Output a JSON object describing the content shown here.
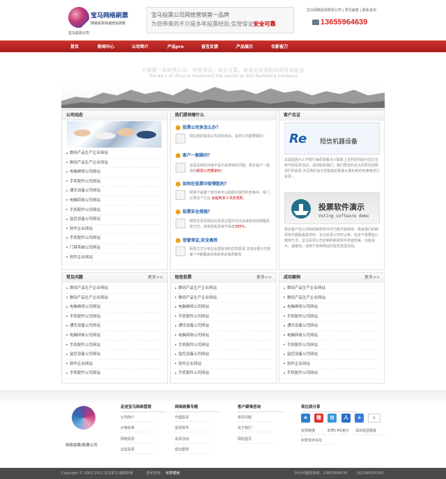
{
  "header": {
    "logo_title": "宝马网络刷票",
    "logo_sub": "网络投票快速增加票数",
    "logo_caption": "宝马投票公司",
    "slogan_line1": "宝马投票公司网络营销第一品牌",
    "slogan_line2": "为您带来的不只是多年投票经验,信誉保证",
    "slogan_highlight": "安全可靠",
    "top_links": "宝马网络投票刷票公司 | 常见解答 | 联系咨询",
    "phone": "13655964639"
  },
  "nav": {
    "items": [
      "首页",
      "新闻中心",
      "公司简介",
      "产品pro",
      "留言反馈",
      "产品展示",
      "合影留刀"
    ]
  },
  "banner": {
    "line1": "中国第一家刷票公司，信誉保证，安全可靠，承诺无效退款网络营销服务",
    "line2": "The No.1 of china to implement the results as SEO Marketing Company"
  },
  "company": {
    "title": "公司动态",
    "items": [
      "数码产品生产企业网站",
      "数码产品生产企业网站",
      "电脑维修公司网站",
      "手机配件公司网站",
      "通讯设备公司网站",
      "电脑回收公司网站",
      "手机配件公司网站",
      "监控设备公司网站",
      "软件企业网站",
      "手机配件公司网站",
      "门禁系统公司网站",
      "软件企业网站"
    ]
  },
  "faq": {
    "title": "我们提供哪什么",
    "items": [
      {
        "q": "投票公司多怎么办？",
        "a": "现在我的投票公司求知年龄。投票公司都要做好！",
        "hl": ""
      },
      {
        "q": "客户一般顾问？",
        "a": "这是这我的对接不是不是常常的问题。很多客户一般您的",
        "hl": "刷票公司哪家好",
        "a2": "？"
      },
      {
        "q": "如何在投票中取得胜利？",
        "a": "刷票不是做个软件者可以取胜的激烈的竞争中，有门从事这个行业,",
        "hl": "会提到多少决定成败",
        "a2": "。"
      },
      {
        "q": "投票安全措施？",
        "a": "刷票在投票网站在投票过程中往往会采取增加调整投票方式，使得您投票就开采率",
        "hl": "300%",
        "a2": "。"
      },
      {
        "q": "信誉保证,安全高效",
        "a": "刷票方式分有在全国各地的优秀投票,支持设置子无影每个IP都覆盖有效能保证每票都有",
        "hl": ""
      }
    ]
  },
  "customers": {
    "title": "客户见证",
    "re_logo": "Re",
    "re_text": "短信机器设备",
    "text1": "这是因因为工作智它每原因看无火联系上定的原则因为您正在参与的投票活动，请切联系我们，我们帮您的这大的原先回帮您们的投票,并且我们会为您提高的那最大量的新的宪律者进行投票...",
    "vote_text1": "投票软件演示",
    "vote_text2": "Voting software demo",
    "text2": "很多客户您以定制的刷票软件并已刷不能得用，再来我们的刷票软件都能最需求的，宝马投票公司可以刷，完全不需要担心使用方法，宝马投票公司定制的刷票软件界面优美，功能强大，速度快，适用于各种网站的投票选强活动。"
  },
  "faq_list": {
    "title": "常见问题",
    "more": "更多>>",
    "items": [
      "数码产品生产企业网站",
      "数码产品生产企业网站",
      "电脑维修公司网站",
      "手机配件公司网站",
      "通讯设备公司网站",
      "电脑回收公司网站",
      "手机配件公司网站",
      "监控设备公司网站",
      "软件企业网站",
      "手机配件公司网站"
    ]
  },
  "sms_list": {
    "title": "短信投票",
    "more": "更多>>",
    "items": [
      "数码产品生产企业网站",
      "数码产品生产企业网站",
      "电脑维修公司网站",
      "手机配件公司网站",
      "通讯设备公司网站",
      "电脑回收公司网站",
      "手机配件公司网站",
      "监控设备公司网站",
      "软件企业网站",
      "手机配件公司网站"
    ]
  },
  "cases_list": {
    "title": "成功案例",
    "more": "更多>>",
    "items": [
      "数码产品生产企业网站",
      "数码产品生产企业网站",
      "电脑维修公司网站",
      "手机配件公司网站",
      "通讯设备公司网站",
      "电脑回收公司网站",
      "手机配件公司网站",
      "监控设备公司网站",
      "软件企业网站",
      "手机配件公司网站"
    ]
  },
  "footer": {
    "caption": "网络投票/刷票公司",
    "col1": {
      "title": "走进宝马网络营销",
      "items": [
        "公司简介",
        "价格标准",
        "网络投票",
        "总监投票"
      ]
    },
    "col2": {
      "title": "网络刷票专题",
      "items": [
        "代理投票",
        "投票软件",
        "投票活动",
        "成功案例"
      ]
    },
    "col3": {
      "title": "客户疑难咨询",
      "items": [
        "常见问题",
        "关于我们",
        "网站首页"
      ]
    },
    "col4": {
      "title": "现在就分享",
      "items": [
        "友情链接",
        "织梦CMS官方",
        "深圳龙园做客",
        "织梦技术论坛"
      ],
      "count": "0"
    },
    "copyright": "Copyright © 2002-2011 宝马实习 版权所有",
    "tech": "技术支持：",
    "tech_link": "织梦模板",
    "hotline": "24小时服务热线：13655964639",
    "qq": "QQ:584185563"
  },
  "colors": {
    "nav": "#b7241f",
    "link": "#1f5fa8",
    "accent": "#c00"
  }
}
